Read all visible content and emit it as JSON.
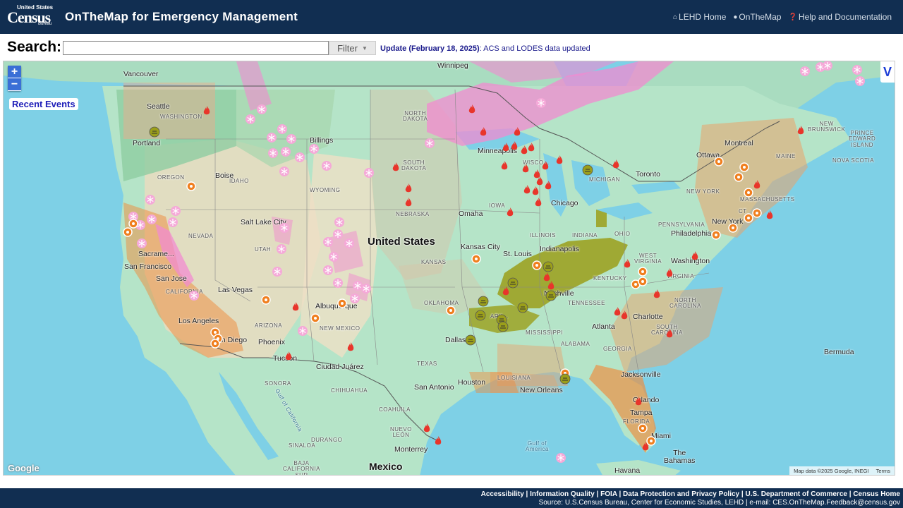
{
  "header": {
    "logo_small": "United States",
    "logo_big": "Census",
    "logo_bureau": "Bureau",
    "title": "OnTheMap for Emergency Management",
    "nav": [
      {
        "label": "LEHD Home",
        "icon": "home-icon"
      },
      {
        "label": "OnTheMap",
        "icon": "map-marker-icon"
      },
      {
        "label": "Help and Documentation",
        "icon": "help-icon"
      }
    ]
  },
  "search": {
    "label": "Search:",
    "value": "",
    "filter_label": "Filter",
    "update_bold": "Update (February 18, 2025)",
    "update_text": ": ACS and LODES data updated"
  },
  "map": {
    "zoom_in": "+",
    "zoom_out": "−",
    "recent_events_label": "Recent Events",
    "panel_toggle": "V",
    "google_logo": "Google",
    "attribution": "Map data ©2025 Google, INEGI",
    "terms": "Terms",
    "labels": {
      "vancouver": "Vancouver",
      "winnipeg": "Winnipeg",
      "seattle": "Seattle",
      "washington_state": "WASHINGTON",
      "portland": "Portland",
      "oregon": "OREGON",
      "boise": "Boise",
      "idaho": "IDAHO",
      "billings": "Billings",
      "wyoming": "WYOMING",
      "north_dakota": "NORTH\nDAKOTA",
      "south_dakota": "SOUTH\nDAKOTA",
      "minneapolis": "Minneapolis",
      "wisconsin": "WISCO...",
      "michigan": "MICHIGAN",
      "toronto": "Toronto",
      "ottawa": "Ottawa",
      "montreal": "Montreal",
      "new_brunswick": "NEW\nBRUNSWICK",
      "pei": "PRINCE\nEDWARD\nISLAND",
      "nova_scotia": "NOVA SCOTIA",
      "maine": "MAINE",
      "new_york": "NEW YORK",
      "massachusetts": "MASSACHUSETTS",
      "ct": "CT",
      "nebraska": "NEBRASKA",
      "omaha": "Omaha",
      "iowa": "IOWA",
      "chicago": "Chicago",
      "illinois": "ILLINOIS",
      "indiana": "INDIANA",
      "ohio": "OHIO",
      "pennsylvania": "PENNSYLVANIA",
      "philadelphia": "Philadelphia",
      "new_york_city": "New York",
      "washington_dc": "Washington",
      "west_virginia": "WEST\nVIRGINIA",
      "virginia": "VIRGINIA",
      "indianapolis": "Indianapolis",
      "st_louis": "St. Louis",
      "kansas_city": "Kansas City",
      "kansas": "KANSAS",
      "nashville": "Nashville",
      "tennessee": "TENNESSEE",
      "kentucky": "KENTUCKY",
      "north_carolina": "NORTH\nCAROLINA",
      "charlotte": "Charlotte",
      "south_carolina": "SOUTH\nCAROLINA",
      "atlanta": "Atlanta",
      "georgia": "GEORGIA",
      "alabama": "ALABAMA",
      "mississippi": "MISSISSIPPI",
      "louisiana": "LOUISIANA",
      "new_orleans": "New Orleans",
      "jacksonville": "Jacksonville",
      "orlando": "Orlando",
      "tampa": "Tampa",
      "miami": "Miami",
      "florida": "FLORIDA",
      "bahamas": "The\nBahamas",
      "havana": "Havana",
      "bermuda": "Bermuda",
      "united_states": "United States",
      "salt_lake_city": "Salt Lake City",
      "utah": "UTAH",
      "nevada": "NEVADA",
      "sacramento": "Sacrame...",
      "san_francisco": "San Francisco",
      "san_jose": "San Jose",
      "california": "CALIFORNIA",
      "las_vegas": "Las Vegas",
      "los_angeles": "Los Angeles",
      "san_diego": "San Diego",
      "arizona": "ARIZONA",
      "phoenix": "Phoenix",
      "tucson": "Tucson",
      "albuquerque": "Albuquerque",
      "new_mexico": "NEW MEXICO",
      "ciudad_juarez": "Ciudad Juárez",
      "oklahoma": "OKLAHOMA",
      "arkansas": "ARK...",
      "dallas": "Dallas",
      "texas": "TEXAS",
      "san_antonio": "San Antonio",
      "houston": "Houston",
      "chihuahua": "CHIHUAHUA",
      "coahuila": "COAHUILA",
      "nuevo_leon": "NUEVO\nLEÓN",
      "monterrey": "Monterrey",
      "mexico": "Mexico",
      "gulf_of_california": "Gulf of California",
      "gulf_of_america": "Gulf of\nAmerica",
      "durango": "DURANGO",
      "sinaloa": "SINALOA",
      "sonora": "SONORA",
      "baja_california_sur": "BAJA\nCALIFORNIA\nSUR"
    }
  },
  "footer": {
    "links": [
      "Accessibility",
      "Information Quality",
      "FOIA",
      "Data Protection and Privacy Policy",
      "U.S. Department of Commerce",
      "Census Home"
    ],
    "source": "Source: U.S.Census Bureau, Center for Economic Studies, LEHD | e-mail: CES.OnTheMap.Feedback@census.gov"
  },
  "colors": {
    "header_bg": "#112e51",
    "ocean": "#7ed0e6",
    "land": "#b5e4c8",
    "fire_icon": "#e8352b",
    "snow_icon": "#f5a9d8",
    "hazard_icon": "#f07f1f",
    "storm_area": "#9b9f1a",
    "winter_area": "#f28bd0"
  }
}
